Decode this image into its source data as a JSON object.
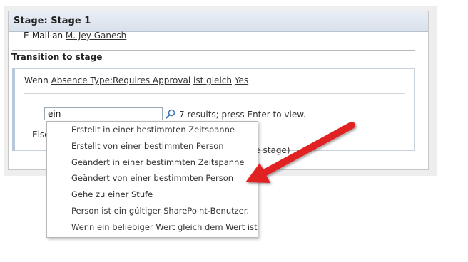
{
  "stage": {
    "title": "Stage: Stage 1"
  },
  "action": {
    "prefix": "E-Mail an",
    "recipient": "M. Jey Ganesh"
  },
  "transition": {
    "title": "Transition to stage"
  },
  "condition": {
    "wenn": "Wenn",
    "field": "Absence Type:Requires Approval",
    "operator": "ist gleich",
    "value": "Yes"
  },
  "search": {
    "value": "ein",
    "results": "7 results; press Enter to view."
  },
  "else": {
    "label": "Else",
    "partial_text": "the stage)"
  },
  "dropdown": {
    "items": [
      "Erstellt in einer bestimmten Zeitspanne",
      "Erstellt von einer bestimmten Person",
      "Geändert in einer bestimmten Zeitspanne",
      "Geändert von einer bestimmten Person",
      "Gehe zu einer Stufe",
      "Person ist ein gültiger SharePoint-Benutzer.",
      "Wenn ein beliebiger Wert gleich dem Wert ist"
    ]
  },
  "colors": {
    "arrow": "#e02020",
    "header": "#dde4ee",
    "panel_border": "#c6c6c6"
  }
}
